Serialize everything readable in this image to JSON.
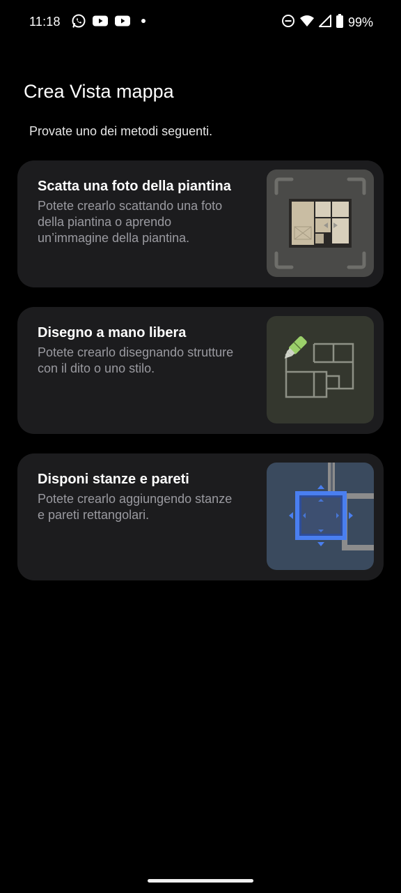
{
  "status_bar": {
    "time": "11:18",
    "notification_icons": [
      "whatsapp-icon",
      "youtube-icon",
      "youtube-icon",
      "dot-icon"
    ],
    "system_icons": [
      "do-not-disturb-icon",
      "wifi-icon",
      "signal-icon",
      "battery-icon"
    ],
    "battery_percent": "99%"
  },
  "page": {
    "title": "Crea Vista mappa",
    "subtitle": "Provate uno dei metodi seguenti."
  },
  "options": [
    {
      "title": "Scatta una foto della piantina",
      "description": "Potete crearlo scattando una foto della piantina o aprendo un’immagine della piantina.",
      "icon": "floorplan-photo-icon",
      "thumb_bg": "#4a4a48"
    },
    {
      "title": "Disegno a mano libera",
      "description": "Potete crearlo disegnando strutture con il dito o uno stilo.",
      "icon": "freehand-draw-icon",
      "thumb_bg": "#34372e"
    },
    {
      "title": "Disponi stanze e pareti",
      "description": "Potete crearlo aggiungendo stanze e pareti rettangolari.",
      "icon": "arrange-rooms-icon",
      "thumb_bg": "#3a4a5e"
    }
  ],
  "colors": {
    "background": "#000000",
    "card": "#1c1c1e",
    "accent_blue": "#4a7ff0",
    "pen_green": "#9bd06a"
  }
}
